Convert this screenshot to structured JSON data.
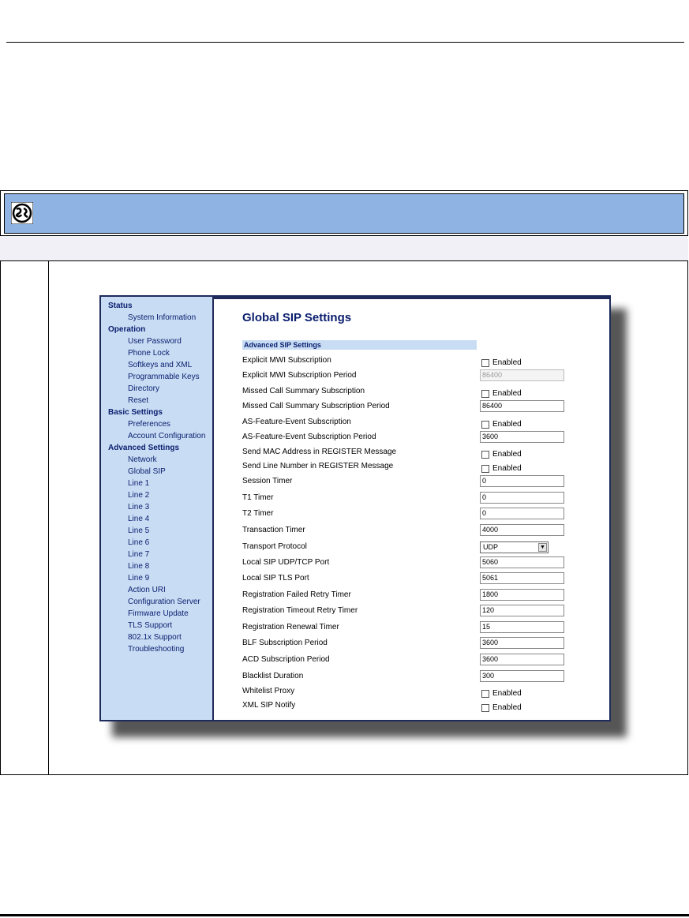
{
  "window": {
    "title": "Global SIP Settings",
    "section": "Advanced SIP Settings"
  },
  "sidebar": {
    "sections": [
      {
        "label": "Status",
        "items": [
          "System Information"
        ]
      },
      {
        "label": "Operation",
        "items": [
          "User Password",
          "Phone Lock",
          "Softkeys and XML",
          "Programmable Keys",
          "Directory",
          "Reset"
        ]
      },
      {
        "label": "Basic Settings",
        "items": [
          "Preferences",
          "Account Configuration"
        ]
      },
      {
        "label": "Advanced Settings",
        "items": [
          "Network",
          "Global SIP",
          "Line 1",
          "Line 2",
          "Line 3",
          "Line 4",
          "Line 5",
          "Line 6",
          "Line 7",
          "Line 8",
          "Line 9",
          "Action URI",
          "Configuration Server",
          "Firmware Update",
          "TLS Support",
          "802.1x Support",
          "Troubleshooting"
        ]
      }
    ]
  },
  "rows": [
    {
      "label": "Explicit MWI Subscription",
      "type": "checkbox",
      "text": "Enabled",
      "checked": false
    },
    {
      "label": "Explicit MWI Subscription Period",
      "type": "text",
      "value": "86400",
      "disabled": true
    },
    {
      "label": "Missed Call Summary Subscription",
      "type": "checkbox",
      "text": "Enabled",
      "checked": false
    },
    {
      "label": "Missed Call Summary Subscription Period",
      "type": "text",
      "value": "86400",
      "disabled": false
    },
    {
      "label": "AS-Feature-Event Subscription",
      "type": "checkbox",
      "text": "Enabled",
      "checked": false
    },
    {
      "label": "AS-Feature-Event Subscription Period",
      "type": "text",
      "value": "3600",
      "disabled": false
    },
    {
      "label": "Send MAC Address in REGISTER Message",
      "type": "checkbox",
      "text": "Enabled",
      "checked": false
    },
    {
      "label": "Send Line Number in REGISTER Message",
      "type": "checkbox",
      "text": "Enabled",
      "checked": false
    },
    {
      "label": "Session Timer",
      "type": "text",
      "value": "0",
      "disabled": false
    },
    {
      "label": "T1 Timer",
      "type": "text",
      "value": "0",
      "disabled": false
    },
    {
      "label": "T2 Timer",
      "type": "text",
      "value": "0",
      "disabled": false
    },
    {
      "label": "Transaction Timer",
      "type": "text",
      "value": "4000",
      "disabled": false
    },
    {
      "label": "Transport Protocol",
      "type": "select",
      "value": "UDP"
    },
    {
      "label": "Local SIP UDP/TCP Port",
      "type": "text",
      "value": "5060",
      "disabled": false
    },
    {
      "label": "Local SIP TLS Port",
      "type": "text",
      "value": "5061",
      "disabled": false
    },
    {
      "label": "Registration Failed Retry Timer",
      "type": "text",
      "value": "1800",
      "disabled": false
    },
    {
      "label": "Registration Timeout Retry Timer",
      "type": "text",
      "value": "120",
      "disabled": false
    },
    {
      "label": "Registration Renewal Timer",
      "type": "text",
      "value": "15",
      "disabled": false
    },
    {
      "label": "BLF Subscription Period",
      "type": "text",
      "value": "3600",
      "disabled": false
    },
    {
      "label": "ACD Subscription Period",
      "type": "text",
      "value": "3600",
      "disabled": false
    },
    {
      "label": "Blacklist Duration",
      "type": "text",
      "value": "300",
      "disabled": false
    },
    {
      "label": "Whitelist Proxy",
      "type": "checkbox",
      "text": "Enabled",
      "checked": false
    },
    {
      "label": "XML SIP Notify",
      "type": "checkbox",
      "text": "Enabled",
      "checked": false
    }
  ],
  "icons": {
    "header": "globe-icon"
  }
}
